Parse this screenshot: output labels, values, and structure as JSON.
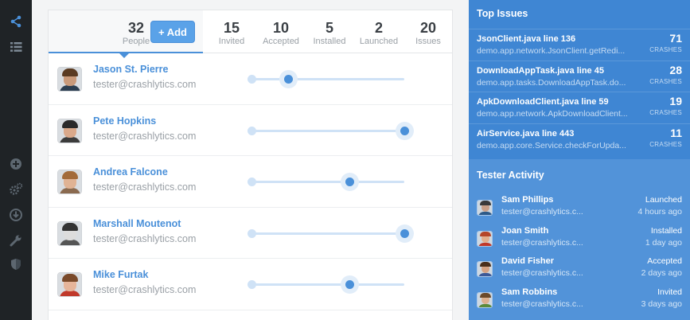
{
  "rail": {
    "icons": [
      "share-icon",
      "list-icon",
      "plus-circle-icon",
      "gears-icon",
      "download-circle-icon",
      "wrench-icon",
      "shield-icon"
    ]
  },
  "stats": {
    "people": {
      "value": "32",
      "label": "People"
    },
    "add_label": "+ Add",
    "invited": {
      "value": "15",
      "label": "Invited"
    },
    "accepted": {
      "value": "10",
      "label": "Accepted"
    },
    "installed": {
      "value": "5",
      "label": "Installed"
    },
    "launched": {
      "value": "2",
      "label": "Launched"
    },
    "issues": {
      "value": "20",
      "label": "Issues"
    }
  },
  "testers": [
    {
      "name": "Jason St. Pierre",
      "email": "tester@crashlytics.com",
      "progress": 0.24,
      "skin": "#c99a7a",
      "hair": "#5a3b22",
      "shirt": "#2c3e50"
    },
    {
      "name": "Pete Hopkins",
      "email": "tester@crashlytics.com",
      "progress": 1.0,
      "skin": "#d9a88a",
      "hair": "#2a2a2a",
      "shirt": "#3b3b3b"
    },
    {
      "name": "Andrea Falcone",
      "email": "tester@crashlytics.com",
      "progress": 0.64,
      "skin": "#e0b394",
      "hair": "#a36b3a",
      "shirt": "#8a6a4f"
    },
    {
      "name": "Marshall Moutenot",
      "email": "tester@crashlytics.com",
      "progress": 1.0,
      "skin": "#ddd",
      "hair": "#333",
      "shirt": "#555"
    },
    {
      "name": "Mike Furtak",
      "email": "tester@crashlytics.com",
      "progress": 0.64,
      "skin": "#e6b59a",
      "hair": "#7a4a2a",
      "shirt": "#c0392b"
    }
  ],
  "top_issues": {
    "title": "Top Issues",
    "count_label": "CRASHES",
    "items": [
      {
        "title": "JsonClient.java line 136",
        "sub": "demo.app.network.JsonClient.getRedi...",
        "count": "71"
      },
      {
        "title": "DownloadAppTask.java line 45",
        "sub": "demo.app.tasks.DownloadAppTask.do...",
        "count": "28"
      },
      {
        "title": "ApkDownloadClient.java line 59",
        "sub": "demo.app.network.ApkDownloadClient...",
        "count": "19"
      },
      {
        "title": "AirService.java line 443",
        "sub": "demo.app.core.Service.checkForUpda...",
        "count": "11"
      }
    ]
  },
  "activity": {
    "title": "Tester Activity",
    "items": [
      {
        "name": "Sam Phillips",
        "email": "tester@crashlytics.c...",
        "status": "Launched",
        "time": "4 hours ago",
        "skin": "#c9a088",
        "hair": "#3a3a3a",
        "shirt": "#2d5a88"
      },
      {
        "name": "Joan Smith",
        "email": "tester@crashlytics.c...",
        "status": "Installed",
        "time": "1 day ago",
        "skin": "#e3b08e",
        "hair": "#b5462a",
        "shirt": "#c0392b"
      },
      {
        "name": "David Fisher",
        "email": "tester@crashlytics.c...",
        "status": "Accepted",
        "time": "2 days ago",
        "skin": "#d4a283",
        "hair": "#4a2f1c",
        "shirt": "#3b5998"
      },
      {
        "name": "Sam Robbins",
        "email": "tester@crashlytics.c...",
        "status": "Invited",
        "time": "3 days ago",
        "skin": "#dcb08e",
        "hair": "#6b4a2a",
        "shirt": "#5a8a3a"
      }
    ]
  }
}
